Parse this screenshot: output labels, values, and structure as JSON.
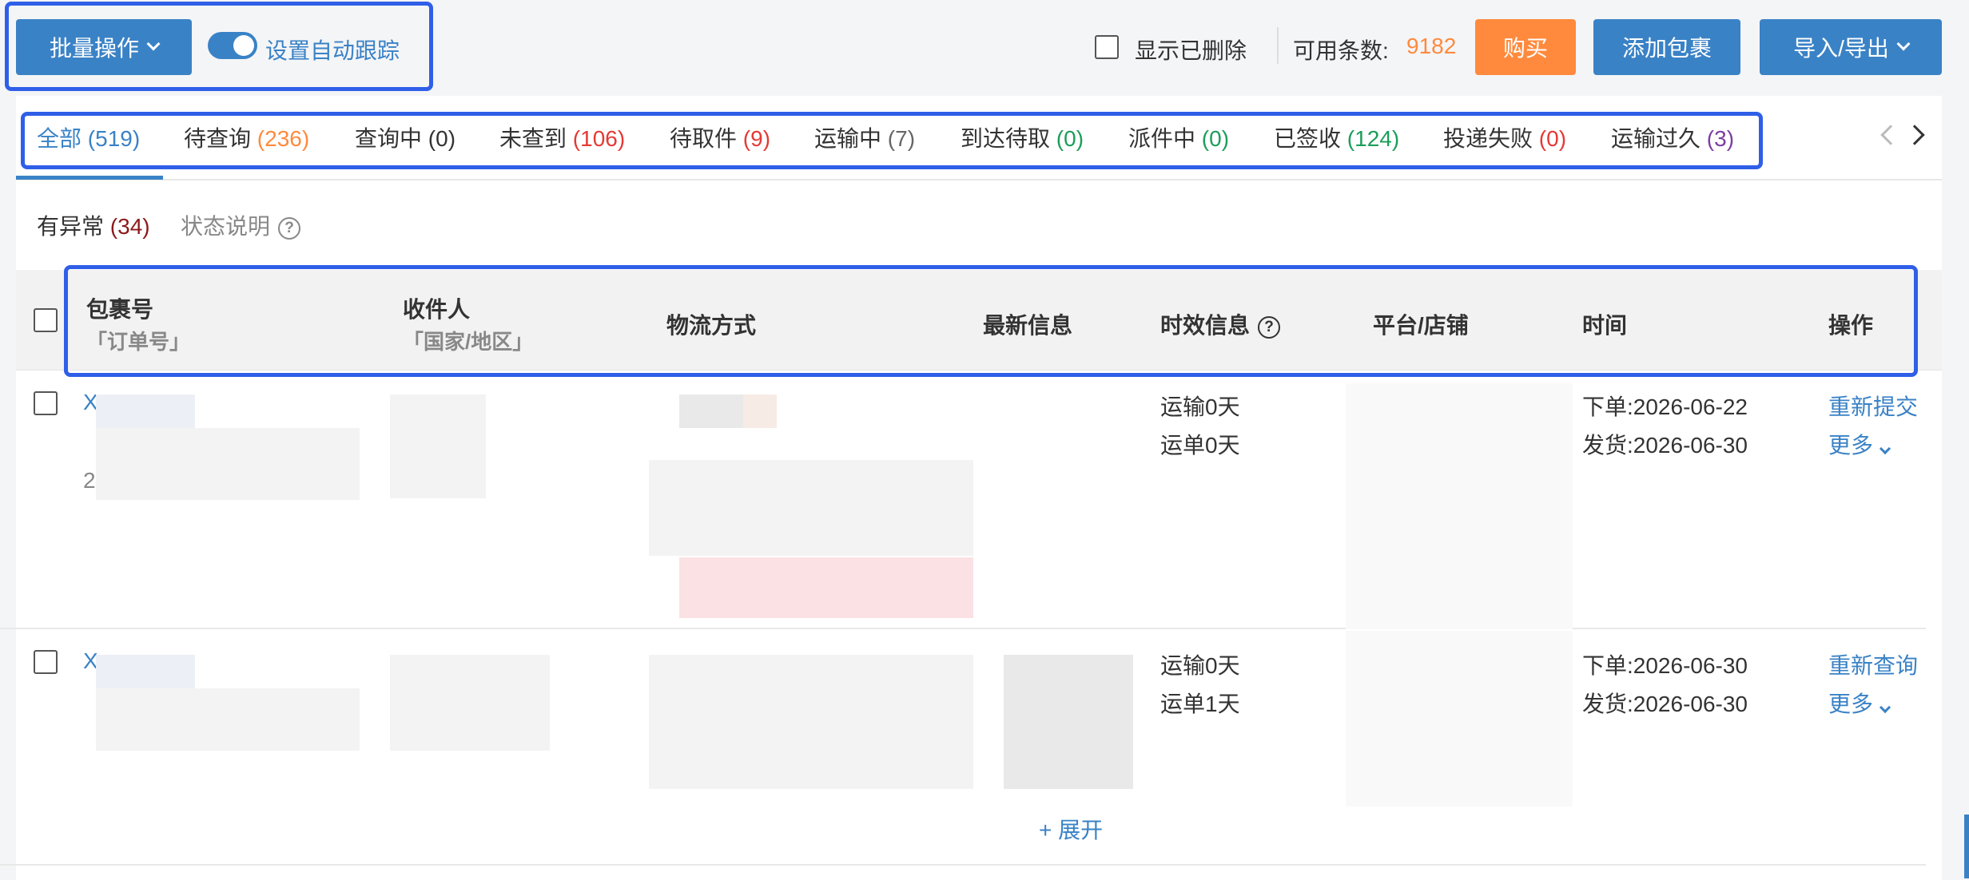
{
  "toolbar": {
    "batch_label": "批量操作",
    "auto_track_label": "设置自动跟踪",
    "show_deleted_label": "显示已删除",
    "available_label": "可用条数:",
    "available_count": "9182",
    "buy_label": "购买",
    "add_package_label": "添加包裹",
    "import_export_label": "导入/导出"
  },
  "tabs": [
    {
      "label": "全部",
      "count": "(519)",
      "color": "#3a82c6"
    },
    {
      "label": "待查询",
      "count": "(236)",
      "color": "#ff8a3d"
    },
    {
      "label": "查询中",
      "count": "(0)",
      "color": "#333333"
    },
    {
      "label": "未查到",
      "count": "(106)",
      "color": "#e53935"
    },
    {
      "label": "待取件",
      "count": "(9)",
      "color": "#e53935"
    },
    {
      "label": "运输中",
      "count": "(7)",
      "color": "#666666"
    },
    {
      "label": "到达待取",
      "count": "(0)",
      "color": "#1b9e5a"
    },
    {
      "label": "派件中",
      "count": "(0)",
      "color": "#1b9e5a"
    },
    {
      "label": "已签收",
      "count": "(124)",
      "color": "#1b9e5a"
    },
    {
      "label": "投递失败",
      "count": "(0)",
      "color": "#e53935"
    },
    {
      "label": "运输过久",
      "count": "(3)",
      "color": "#7b3fa0"
    }
  ],
  "subfilter": {
    "abnormal_label": "有异常",
    "abnormal_count": "(34)",
    "status_help": "状态说明"
  },
  "table": {
    "headers": {
      "package": "包裹号",
      "package_sub": "「订单号」",
      "recipient": "收件人",
      "recipient_sub": "「国家/地区」",
      "logistics": "物流方式",
      "latest": "最新信息",
      "timeliness": "时效信息",
      "platform": "平台/店铺",
      "time": "时间",
      "action": "操作"
    },
    "rows": [
      {
        "id_prefix": "X",
        "order_prefix": "2",
        "timeliness": [
          "运输0天",
          "运单0天"
        ],
        "time": [
          "下单:2026-06-22",
          "发货:2026-06-30"
        ],
        "action": "重新提交",
        "more": "更多"
      },
      {
        "id_prefix": "X",
        "timeliness": [
          "运输0天",
          "运单1天"
        ],
        "time": [
          "下单:2026-06-30",
          "发货:2026-06-30"
        ],
        "action": "重新查询",
        "more": "更多"
      }
    ],
    "expand_label": "+ 展开"
  }
}
